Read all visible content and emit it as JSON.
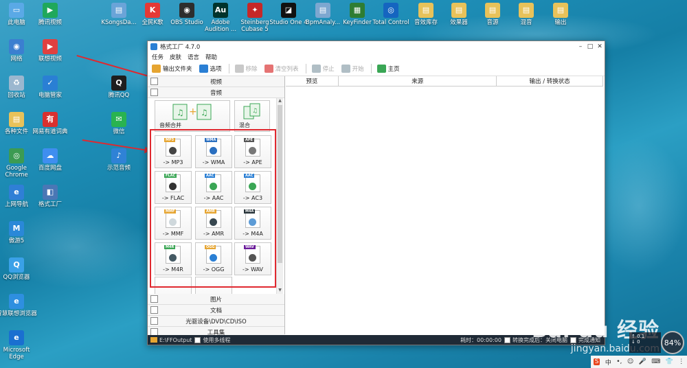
{
  "desktop": {
    "left_icons": [
      {
        "label": "此电脑",
        "color": "#5aa9e6",
        "glyph": "▭"
      },
      {
        "label": "网络",
        "color": "#3b7fd0",
        "glyph": "◉"
      },
      {
        "label": "回收站",
        "color": "#9bb7cf",
        "glyph": "♻"
      },
      {
        "label": "各种文件",
        "color": "#e8c25a",
        "glyph": "▤"
      },
      {
        "label": "Google Chrome",
        "color": "#3c9b52",
        "glyph": "◎"
      },
      {
        "label": "上网导航",
        "color": "#2f7fd6",
        "glyph": "e"
      },
      {
        "label": "傲游5",
        "color": "#2a88d8",
        "glyph": "M"
      },
      {
        "label": "QQ浏览器",
        "color": "#3aa1e8",
        "glyph": "Q"
      },
      {
        "label": "智慧联想浏览器",
        "color": "#2e8fe0",
        "glyph": "e"
      },
      {
        "label": "Microsoft Edge",
        "color": "#1a6fd0",
        "glyph": "e"
      }
    ],
    "second_col_icons": [
      {
        "label": "腾讯视频",
        "color": "#1fa85b",
        "glyph": "▶"
      },
      {
        "label": "联想视频",
        "color": "#e04040",
        "glyph": "▶"
      },
      {
        "label": "电脑管家",
        "color": "#2a7fd4",
        "glyph": "✓"
      },
      {
        "label": "网易有道词典",
        "color": "#d9302f",
        "glyph": "有"
      },
      {
        "label": "百度网盘",
        "color": "#3f8ef0",
        "glyph": "☁"
      },
      {
        "label": "格式工厂",
        "color": "#4a77b5",
        "glyph": "◧"
      }
    ],
    "third_col_icons": [
      {
        "label": "腾讯QQ",
        "color": "#1e1e1e",
        "glyph": "Q"
      },
      {
        "label": "微信",
        "color": "#29b350",
        "glyph": "✉"
      },
      {
        "label": "示范音频",
        "color": "#2f82d6",
        "glyph": "♪"
      }
    ],
    "top_icons": [
      {
        "label": "KSongsDa...",
        "color": "#6aa4d8",
        "glyph": "▤"
      },
      {
        "label": "全民K歌",
        "color": "#e53935",
        "glyph": "K"
      },
      {
        "label": "OBS Studio",
        "color": "#2d2d2d",
        "glyph": "◉"
      },
      {
        "label": "Adobe Audition ...",
        "color": "#00332c",
        "glyph": "Au"
      },
      {
        "label": "Steinberg Cubase 5",
        "color": "#c62828",
        "glyph": "✦"
      },
      {
        "label": "Studio One 4",
        "color": "#111111",
        "glyph": "◪"
      },
      {
        "label": "BpmAnaly...",
        "color": "#7da7d0",
        "glyph": "▤"
      },
      {
        "label": "KeyFinder",
        "color": "#2e7d32",
        "glyph": "▦"
      },
      {
        "label": "Total Control",
        "color": "#1565c0",
        "glyph": "◎"
      },
      {
        "label": "音效库存",
        "color": "#e8c25a",
        "glyph": "▤"
      },
      {
        "label": "效果器",
        "color": "#e8c25a",
        "glyph": "▤"
      },
      {
        "label": "音源",
        "color": "#e8c25a",
        "glyph": "▤"
      },
      {
        "label": "混音",
        "color": "#e8c25a",
        "glyph": "▤"
      },
      {
        "label": "输出",
        "color": "#e8c25a",
        "glyph": "▤"
      }
    ]
  },
  "window": {
    "title": "格式工厂 4.7.0",
    "controls": [
      "–",
      "□",
      "✕"
    ],
    "menu": [
      "任务",
      "皮肤",
      "语言",
      "帮助"
    ],
    "toolbar": [
      {
        "label": "输出文件夹",
        "enabled": true,
        "color": "#e6a531"
      },
      {
        "label": "选项",
        "enabled": true,
        "color": "#2a7fd4"
      },
      {
        "label": "移除",
        "enabled": false,
        "color": "#c9c9c9"
      },
      {
        "label": "清空列表",
        "enabled": false,
        "color": "#e57373"
      },
      {
        "label": "停止",
        "enabled": false,
        "color": "#b0bec5"
      },
      {
        "label": "开始",
        "enabled": false,
        "color": "#b0bec5"
      },
      {
        "label": "主页",
        "enabled": true,
        "color": "#3aa655"
      }
    ],
    "categories_top": [
      "视频",
      "音频"
    ],
    "merge_tiles": [
      {
        "label": "音频合并"
      },
      {
        "label": "混合"
      }
    ],
    "audio_tiles": [
      {
        "label": "-> MP3",
        "tag": "MP3",
        "tagcolor": "#e6a531",
        "sym": "#444444"
      },
      {
        "label": "-> WMA",
        "tag": "WMA",
        "tagcolor": "#2a6fc0",
        "sym": "#2a6fc0"
      },
      {
        "label": "-> APE",
        "tag": "APE",
        "tagcolor": "#555555",
        "sym": "#777777"
      },
      {
        "label": "-> FLAC",
        "tag": "FLAC",
        "tagcolor": "#3aa655",
        "sym": "#333333"
      },
      {
        "label": "-> AAC",
        "tag": "AAC",
        "tagcolor": "#2a7fd4",
        "sym": "#3aa655"
      },
      {
        "label": "-> AC3",
        "tag": "AAC",
        "tagcolor": "#2a7fd4",
        "sym": "#3aa655"
      },
      {
        "label": "-> MMF",
        "tag": "MMF",
        "tagcolor": "#e6a531",
        "sym": "#cfd8dc"
      },
      {
        "label": "-> AMR",
        "tag": "AMR",
        "tagcolor": "#e6a531",
        "sym": "#37474f"
      },
      {
        "label": "-> M4A",
        "tag": "M4A",
        "tagcolor": "#263238",
        "sym": "#5c9bd6"
      },
      {
        "label": "-> M4R",
        "tag": "M4R",
        "tagcolor": "#3aa655",
        "sym": "#455a64"
      },
      {
        "label": "-> OGG",
        "tag": "OGG",
        "tagcolor": "#e6a531",
        "sym": "#2a7fd4"
      },
      {
        "label": "-> WAV",
        "tag": "WAV",
        "tagcolor": "#6a1b9a",
        "sym": "#555555"
      }
    ],
    "categories_bottom": [
      "图片",
      "文档",
      "光驱设备\\DVD\\CD\\ISO",
      "工具集"
    ],
    "table_headers": [
      "预览",
      "来源",
      "输出 / 转换状态"
    ],
    "status": {
      "path": "E:\\FFOutput",
      "multithread": "使用多线程",
      "elapsed": "耗时：00:00:00",
      "after_convert": "转换完成后：关闭电脑",
      "notify": "完成通知"
    }
  },
  "watermark": {
    "main": "Bai du 经验",
    "sub": "jingyan.baidu.com"
  },
  "tray": {
    "items": [
      "S",
      "中",
      "•,",
      "☺",
      "🎤",
      "⌨",
      "👕",
      "⋮"
    ]
  },
  "net_speed": {
    "up": "0.1",
    "down": "0"
  },
  "cpu_gauge": "84%"
}
